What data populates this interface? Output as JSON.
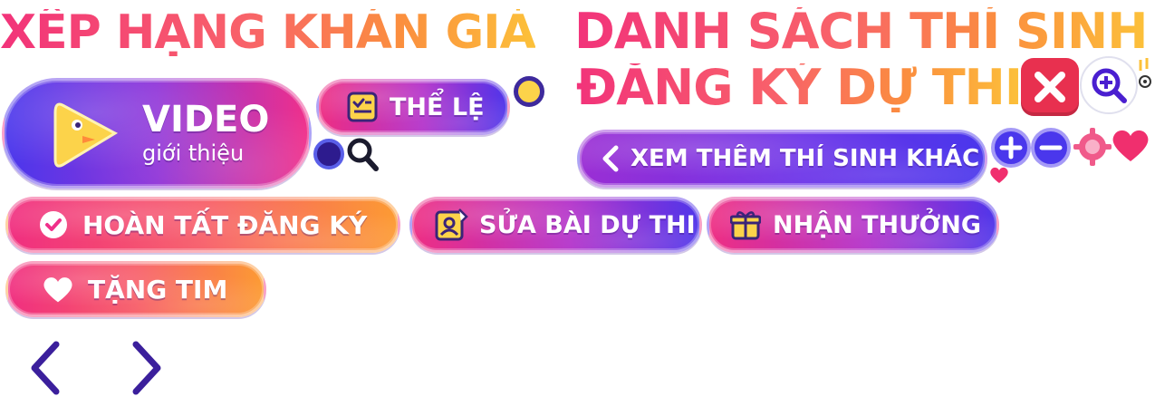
{
  "titles": {
    "audience_ranking": "XẾP HẠNG KHÁN GIẢ",
    "contestant_list_line1": "DANH SÁCH THÍ SINH",
    "contestant_list_line2": "ĐĂNG KÝ DỰ THI"
  },
  "buttons": {
    "video_title": "VIDEO",
    "video_subtitle": "giới thiệu",
    "rules": "THỂ LỆ",
    "more_contestants": "XEM THÊM THÍ SINH KHÁC",
    "complete_registration": "HOÀN TẤT ĐĂNG KÝ",
    "edit_entry": "SỬA BÀI DỰ THI",
    "receive_reward": "NHẬN THƯỞNG",
    "give_heart": "TẶNG TIM"
  },
  "icons": {
    "play": "play-icon",
    "rules": "clipboard-check-icon",
    "back": "chevron-left-icon",
    "check": "check-circle-icon",
    "edit": "edit-profile-icon",
    "gift": "gift-icon",
    "heart": "heart-icon",
    "close": "close-icon",
    "zoom_in": "zoom-in-icon",
    "plus": "plus-icon",
    "minus": "minus-icon",
    "gear": "gear-icon",
    "search": "search-icon",
    "prev": "arrow-left-icon",
    "next": "arrow-right-icon"
  },
  "colors": {
    "pink": "#f0308a",
    "purple": "#5036ea",
    "orange": "#fc9b33",
    "yellow": "#fcd34a",
    "navy": "#2d1b8e",
    "red": "#e8304f"
  }
}
